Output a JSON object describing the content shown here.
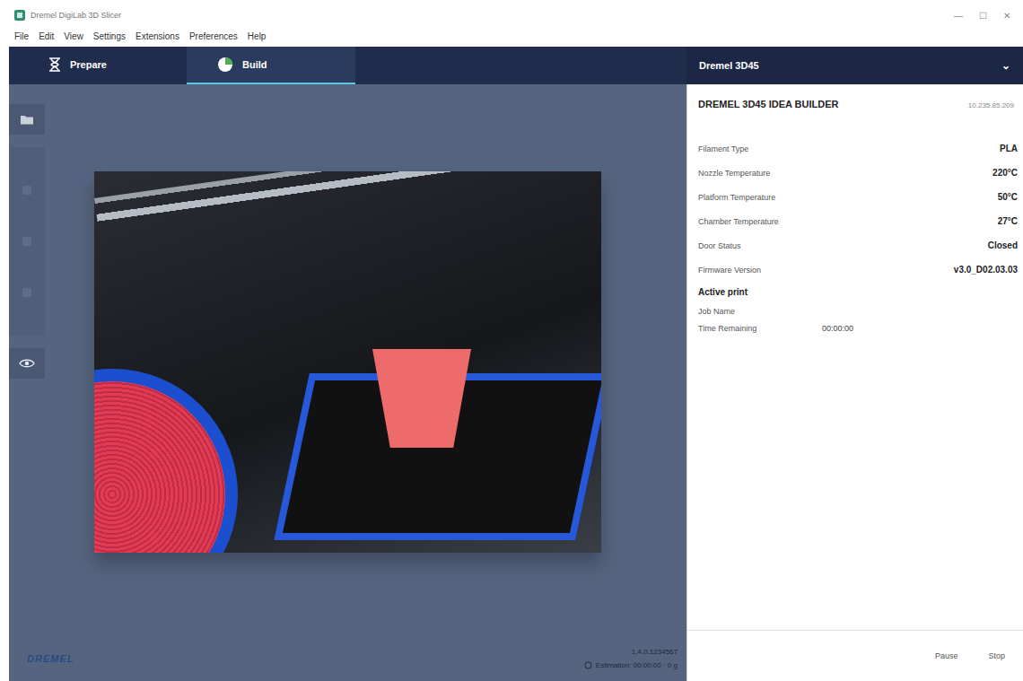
{
  "window": {
    "title": "Dremel DigiLab 3D Slicer",
    "controls": [
      "—",
      "☐",
      "✕"
    ]
  },
  "menu": [
    "File",
    "Edit",
    "View",
    "Settings",
    "Extensions",
    "Preferences",
    "Help"
  ],
  "tabs": [
    {
      "label": "Prepare",
      "selected": false
    },
    {
      "label": "Build",
      "selected": true
    }
  ],
  "printer_select": {
    "value": "Dremel 3D45",
    "arrow": "⌄"
  },
  "printer": {
    "name": "DREMEL 3D45 IDEA BUILDER",
    "address": "10.235.85.209",
    "properties": [
      {
        "label": "Filament Type",
        "value": "PLA"
      },
      {
        "label": "Nozzle Temperature",
        "value": "220°C"
      },
      {
        "label": "Platform Temperature",
        "value": "50°C"
      },
      {
        "label": "Chamber Temperature",
        "value": "27°C"
      },
      {
        "label": "Door Status",
        "value": "Closed"
      },
      {
        "label": "Firmware Version",
        "value": "v3.0_D02.03.03"
      }
    ]
  },
  "active_print": {
    "title": "Active print",
    "fields": [
      {
        "label": "Job Name",
        "value": ""
      },
      {
        "label": "Time Remaining",
        "value": "00:00:00"
      }
    ]
  },
  "footer": {
    "logo": "DREMEL",
    "version": "1.4.0.1234567",
    "estimate": "Estimation: 00:00:00 · 0 g"
  },
  "buttons": [
    "Pause",
    "Stop"
  ]
}
